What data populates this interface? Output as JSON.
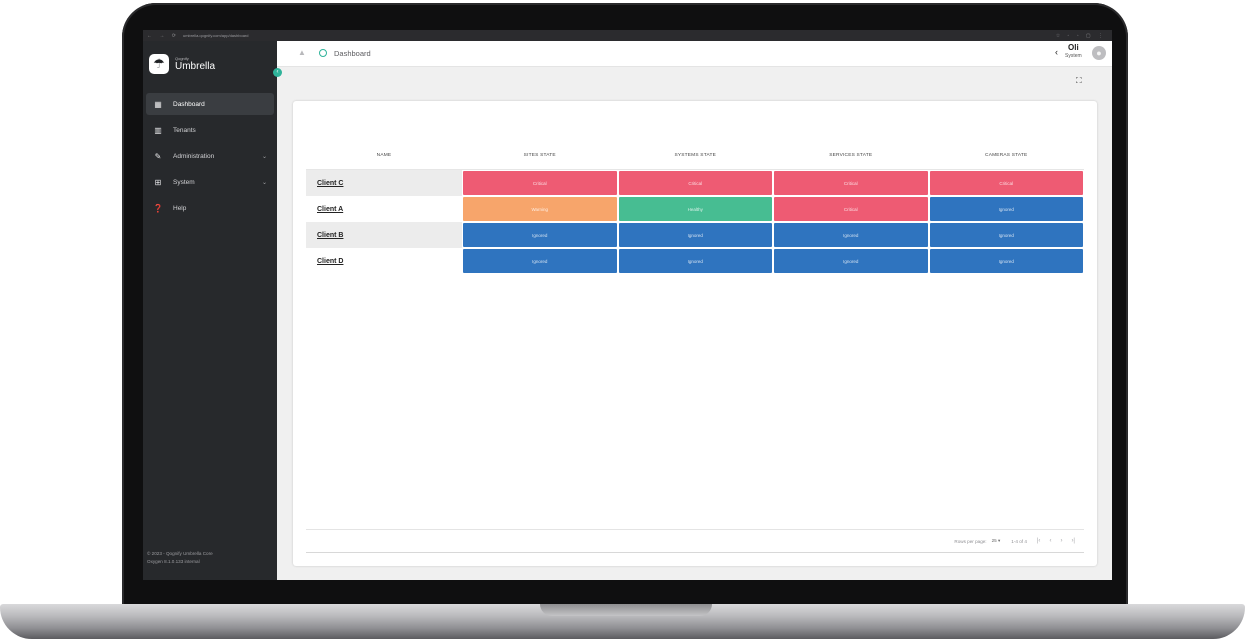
{
  "browser": {
    "url": "umbrella.qognify.com/app/dashboard"
  },
  "brand": {
    "company": "Qognify",
    "product": "Umbrella"
  },
  "sidebar": {
    "items": [
      {
        "label": "Dashboard",
        "icon": "dashboard-icon",
        "active": true
      },
      {
        "label": "Tenants",
        "icon": "building-icon"
      },
      {
        "label": "Administration",
        "icon": "wrench-icon",
        "expandable": true
      },
      {
        "label": "System",
        "icon": "server-icon",
        "expandable": true
      },
      {
        "label": "Help",
        "icon": "help-icon"
      }
    ],
    "footer_line1": "© 2023 - Qognify Umbrella Core",
    "footer_line2": "Oxygen 8.1.0.133 internal"
  },
  "topbar": {
    "title": "Dashboard",
    "user_name": "Oli",
    "user_role": "System"
  },
  "table": {
    "headers": [
      "NAME",
      "SITES STATE",
      "SYSTEMS STATE",
      "SERVICES STATE",
      "CAMERAS STATE"
    ],
    "rows": [
      {
        "name": "Client C",
        "states": [
          "Critical",
          "Critical",
          "Critical",
          "Critical"
        ]
      },
      {
        "name": "Client A",
        "states": [
          "Warning",
          "Healthy",
          "Critical",
          "Ignored"
        ]
      },
      {
        "name": "Client B",
        "states": [
          "Ignored",
          "Ignored",
          "Ignored",
          "Ignored"
        ]
      },
      {
        "name": "Client D",
        "states": [
          "Ignored",
          "Ignored",
          "Ignored",
          "Ignored"
        ]
      }
    ]
  },
  "status_colors": {
    "Critical": "#ee5b73",
    "Warning": "#f7a56b",
    "Healthy": "#47bd92",
    "Ignored": "#2f74bf"
  },
  "pagination": {
    "rows_per_page_label": "Rows per page:",
    "rows_per_page_value": "25 ▾",
    "range": "1-4 of 4"
  }
}
